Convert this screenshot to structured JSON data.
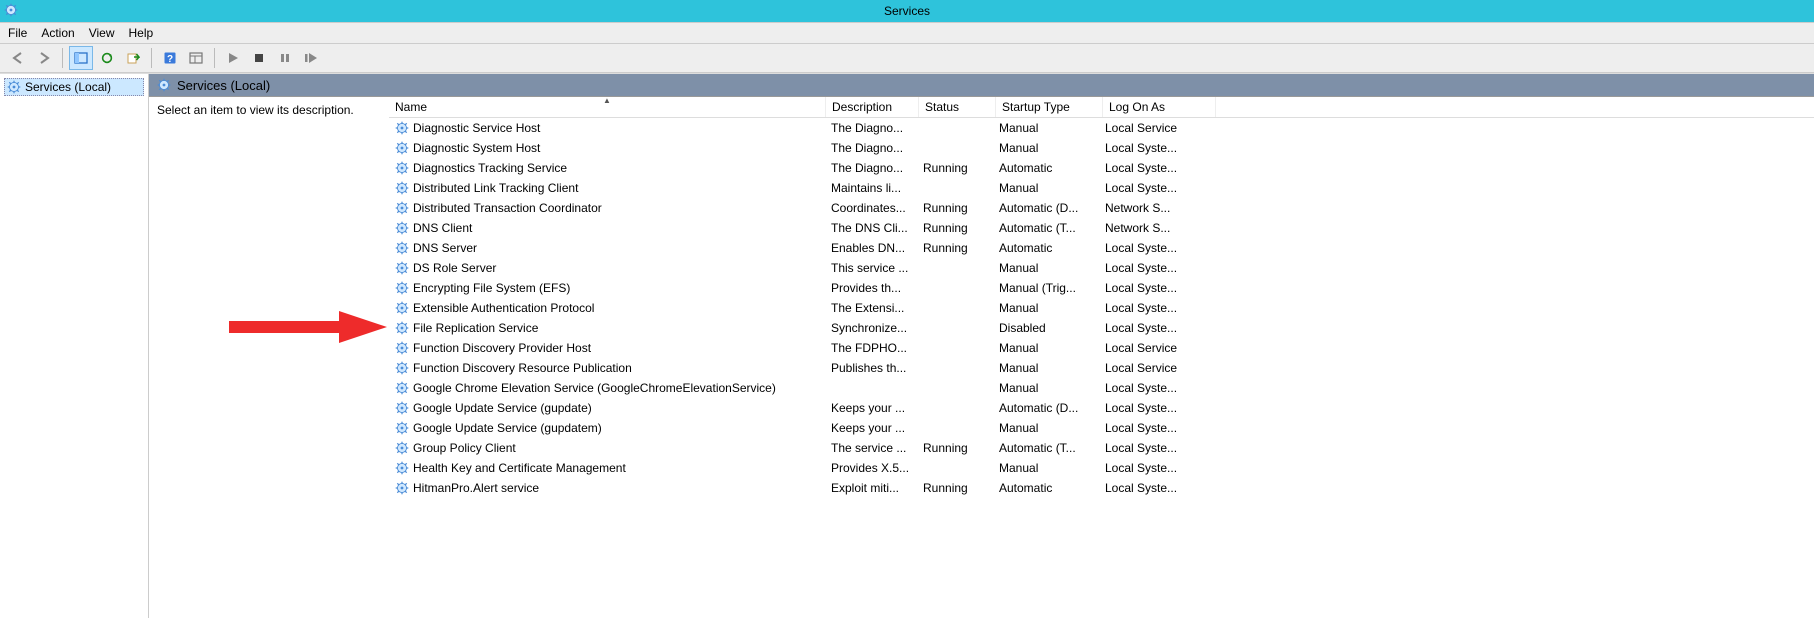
{
  "window": {
    "title": "Services"
  },
  "menu": {
    "file": "File",
    "action": "Action",
    "view": "View",
    "help": "Help"
  },
  "tree": {
    "root": "Services (Local)"
  },
  "pane": {
    "header": "Services (Local)",
    "description_prompt": "Select an item to view its description."
  },
  "columns": {
    "name": "Name",
    "description": "Description",
    "status": "Status",
    "startup": "Startup Type",
    "logon": "Log On As"
  },
  "services": [
    {
      "name": "Diagnostic Service Host",
      "desc": "The Diagno...",
      "status": "",
      "startup": "Manual",
      "logon": "Local Service"
    },
    {
      "name": "Diagnostic System Host",
      "desc": "The Diagno...",
      "status": "",
      "startup": "Manual",
      "logon": "Local Syste..."
    },
    {
      "name": "Diagnostics Tracking Service",
      "desc": "The Diagno...",
      "status": "Running",
      "startup": "Automatic",
      "logon": "Local Syste..."
    },
    {
      "name": "Distributed Link Tracking Client",
      "desc": "Maintains li...",
      "status": "",
      "startup": "Manual",
      "logon": "Local Syste..."
    },
    {
      "name": "Distributed Transaction Coordinator",
      "desc": "Coordinates...",
      "status": "Running",
      "startup": "Automatic (D...",
      "logon": "Network S..."
    },
    {
      "name": "DNS Client",
      "desc": "The DNS Cli...",
      "status": "Running",
      "startup": "Automatic (T...",
      "logon": "Network S..."
    },
    {
      "name": "DNS Server",
      "desc": "Enables DN...",
      "status": "Running",
      "startup": "Automatic",
      "logon": "Local Syste..."
    },
    {
      "name": "DS Role Server",
      "desc": "This service ...",
      "status": "",
      "startup": "Manual",
      "logon": "Local Syste..."
    },
    {
      "name": "Encrypting File System (EFS)",
      "desc": "Provides th...",
      "status": "",
      "startup": "Manual (Trig...",
      "logon": "Local Syste..."
    },
    {
      "name": "Extensible Authentication Protocol",
      "desc": "The Extensi...",
      "status": "",
      "startup": "Manual",
      "logon": "Local Syste..."
    },
    {
      "name": "File Replication Service",
      "desc": "Synchronize...",
      "status": "",
      "startup": "Disabled",
      "logon": "Local Syste..."
    },
    {
      "name": "Function Discovery Provider Host",
      "desc": "The FDPHO...",
      "status": "",
      "startup": "Manual",
      "logon": "Local Service"
    },
    {
      "name": "Function Discovery Resource Publication",
      "desc": "Publishes th...",
      "status": "",
      "startup": "Manual",
      "logon": "Local Service"
    },
    {
      "name": "Google Chrome Elevation Service (GoogleChromeElevationService)",
      "desc": "",
      "status": "",
      "startup": "Manual",
      "logon": "Local Syste..."
    },
    {
      "name": "Google Update Service (gupdate)",
      "desc": "Keeps your ...",
      "status": "",
      "startup": "Automatic (D...",
      "logon": "Local Syste..."
    },
    {
      "name": "Google Update Service (gupdatem)",
      "desc": "Keeps your ...",
      "status": "",
      "startup": "Manual",
      "logon": "Local Syste..."
    },
    {
      "name": "Group Policy Client",
      "desc": "The service ...",
      "status": "Running",
      "startup": "Automatic (T...",
      "logon": "Local Syste..."
    },
    {
      "name": "Health Key and Certificate Management",
      "desc": "Provides X.5...",
      "status": "",
      "startup": "Manual",
      "logon": "Local Syste..."
    },
    {
      "name": "HitmanPro.Alert service",
      "desc": "Exploit miti...",
      "status": "Running",
      "startup": "Automatic",
      "logon": "Local Syste..."
    }
  ],
  "annotation": {
    "arrow_target_index": 10
  }
}
